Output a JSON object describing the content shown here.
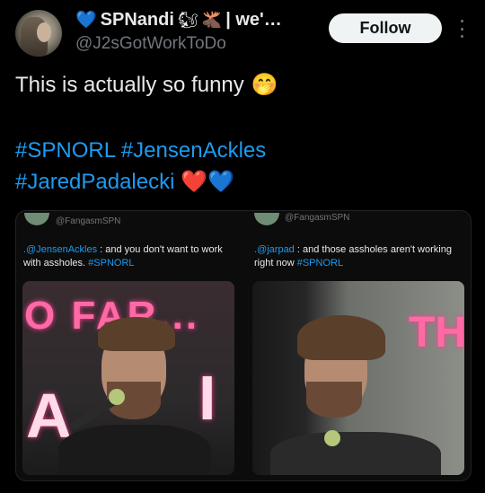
{
  "author": {
    "name": "SPNandi",
    "name_suffix": "| we'…",
    "handle": "@J2sGotWorkToDo",
    "name_icons": [
      "blue-heart-icon",
      "squirrel-icon",
      "moose-icon"
    ]
  },
  "follow_label": "Follow",
  "post": {
    "text": "This is actually so funny",
    "emoji": "🤭",
    "hashtags_line1": [
      "#SPNORL",
      "#JensenAckles"
    ],
    "hashtags_line2": [
      "#JaredPadalecki"
    ],
    "hearts": [
      "red-heart-icon",
      "blue-heart-icon"
    ]
  },
  "embedded": {
    "left": {
      "handle": "@FangasmSPN",
      "mention": ".@JensenAckles",
      "text": " : and you don't want to work with assholes. ",
      "tag": "#SPNORL",
      "sign_text": "O FAR..."
    },
    "right": {
      "handle": "@FangasmSPN",
      "mention": ".@jarpad",
      "text": " : and those assholes aren't working right now ",
      "tag": "#SPNORL",
      "sign_text": "TH"
    }
  },
  "colors": {
    "background": "#000000",
    "text": "#e7e9ea",
    "muted": "#71767b",
    "link": "#1d9bf0",
    "follow_bg": "#eff3f4"
  }
}
